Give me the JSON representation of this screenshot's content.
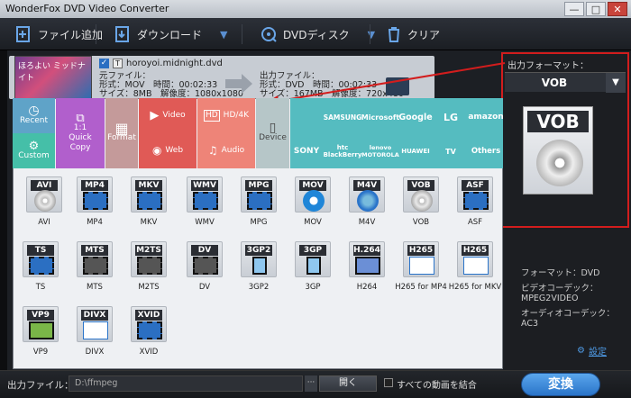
{
  "app": {
    "title": "WonderFox DVD Video Converter",
    "win_buttons": [
      "—",
      "□",
      "✕"
    ]
  },
  "toolbar": {
    "add_file": "ファイル追加",
    "download": "ダウンロード",
    "dvd_disc": "DVDディスク",
    "clear": "クリア"
  },
  "file": {
    "name": "horoyoi.midnight.dvd",
    "checkbox_tag": "T",
    "src_label": "元ファイル：",
    "src_line1": "形式：MOV　時間：00:02:33",
    "src_line2": "サイズ：8MB　解像度：1080x1080",
    "out_label": "出力ファイル：",
    "out_line1": "形式：DVD　時間：00:02:33",
    "out_line2": "サイズ：167MB　解像度：720x480",
    "thumb_text": "ほろよい ミッドナイト"
  },
  "right_panel": {
    "output_format_label": "出力フォーマット：",
    "selected_format": "VOB",
    "big_icon_label": "VOB",
    "info_format": "フォーマット：DVD",
    "info_video_codec_label": "ビデオコーデック：",
    "info_video_codec": "MPEG2VIDEO",
    "info_audio_codec_label": "オーディオコーデック：",
    "info_audio_codec": "AC3",
    "settings": "設定"
  },
  "bottom": {
    "output_label": "出力ファイル：",
    "output_path": "D:\\ffmpeg",
    "more": "···",
    "open": "開く",
    "merge_label": "すべての動画を結合",
    "convert": "変換"
  },
  "categories": {
    "recent": "Recent",
    "custom": "Custom",
    "quick_copy": "1:1\nQuick\nCopy",
    "format": "Format",
    "video": "Video",
    "hd4k": "HD/4K",
    "web": "Web",
    "audio": "Audio",
    "device": "Device"
  },
  "brands": [
    "SAMSUNG",
    "Microsoft",
    "Google",
    "LG",
    "amazon",
    "SONY",
    "htc BlackBerry",
    "lenovo MOTOROLA",
    "HUAWEI",
    "TV",
    "Others"
  ],
  "formats": [
    {
      "icon": "AVI",
      "label": "AVI"
    },
    {
      "icon": "MP4",
      "label": "MP4"
    },
    {
      "icon": "MKV",
      "label": "MKV"
    },
    {
      "icon": "WMV",
      "label": "WMV"
    },
    {
      "icon": "MPG",
      "label": "MPG"
    },
    {
      "icon": "MOV",
      "label": "MOV"
    },
    {
      "icon": "M4V",
      "label": "M4V"
    },
    {
      "icon": "VOB",
      "label": "VOB"
    },
    {
      "icon": "ASF",
      "label": "ASF"
    },
    {
      "icon": "TS",
      "label": "TS"
    },
    {
      "icon": "MTS",
      "label": "MTS"
    },
    {
      "icon": "M2TS",
      "label": "M2TS"
    },
    {
      "icon": "DV",
      "label": "DV"
    },
    {
      "icon": "3GP2",
      "label": "3GP2"
    },
    {
      "icon": "3GP",
      "label": "3GP"
    },
    {
      "icon": "H.264",
      "label": "H264"
    },
    {
      "icon": "H265",
      "label": "H265 for MP4"
    },
    {
      "icon": "H265",
      "label": "H265 for MKV"
    },
    {
      "icon": "VP9",
      "label": "VP9"
    },
    {
      "icon": "DIVX",
      "label": "DIVX"
    },
    {
      "icon": "XVID",
      "label": "XVID"
    }
  ],
  "colors": {
    "recent": "#5fa3c8",
    "custom": "#45bfa8",
    "quick_copy": "#b15fcc",
    "format": "#c49a9a",
    "video_web": "#e05a56",
    "hd4k_audio": "#ee8478",
    "device": "#b6c6c8",
    "brands": "#55bcc0",
    "highlight": "#d21d1d",
    "convert": "#3a8ad8"
  }
}
